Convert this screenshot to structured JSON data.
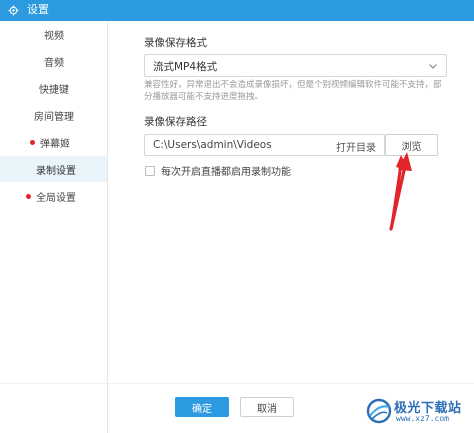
{
  "window": {
    "title": "设置"
  },
  "sidebar": {
    "items": [
      {
        "label": "视频",
        "active": false,
        "dot": false
      },
      {
        "label": "音频",
        "active": false,
        "dot": false
      },
      {
        "label": "快捷键",
        "active": false,
        "dot": false
      },
      {
        "label": "房间管理",
        "active": false,
        "dot": false
      },
      {
        "label": "弹幕姬",
        "active": false,
        "dot": true
      },
      {
        "label": "录制设置",
        "active": true,
        "dot": false
      },
      {
        "label": "全局设置",
        "active": false,
        "dot": true
      }
    ]
  },
  "record": {
    "format_title": "录像保存格式",
    "format_value": "流式MP4格式",
    "format_hint": "兼容性好，异常退出不会造成录像损坏，但是个别视频编辑软件可能不支持，部分播放器可能不支持进度拖拽。",
    "path_title": "录像保存路径",
    "path_value": "C:\\Users\\admin\\Videos",
    "open_dir_label": "打开目录",
    "browse_label": "浏览",
    "auto_record_label": "每次开启直播都启用录制功能",
    "auto_record_checked": false
  },
  "footer": {
    "ok_label": "确定",
    "cancel_label": "取消"
  },
  "watermark": {
    "name": "极光下载站",
    "url": "www.xz7.com"
  },
  "colors": {
    "accent": "#2c9ae0",
    "active_bg": "#e9f4fb",
    "dot": "#e0262b",
    "annotation_arrow": "#e0262b"
  }
}
